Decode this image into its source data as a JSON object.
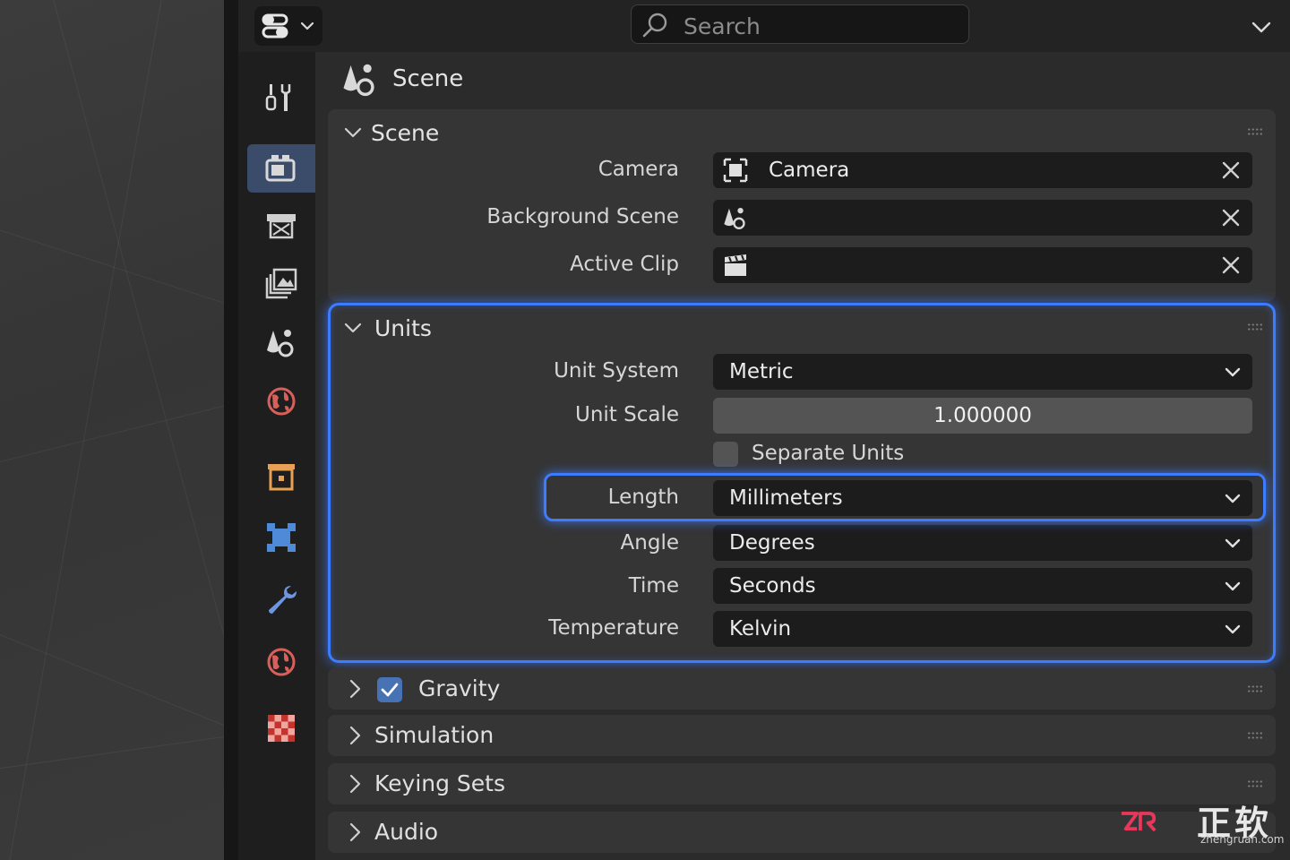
{
  "header": {
    "search_placeholder": "Search"
  },
  "properties": {
    "title": "Scene",
    "tabs": [
      {
        "name": "tool",
        "active": false
      },
      {
        "name": "render",
        "active": true
      },
      {
        "name": "output",
        "active": false
      },
      {
        "name": "view-layer",
        "active": false
      },
      {
        "name": "scene",
        "active": false
      },
      {
        "name": "world",
        "active": false
      },
      {
        "name": "collection",
        "active": false
      },
      {
        "name": "object",
        "active": false
      },
      {
        "name": "modifiers",
        "active": false
      },
      {
        "name": "physics",
        "active": false
      },
      {
        "name": "texture",
        "active": false
      }
    ]
  },
  "scene_panel": {
    "title": "Scene",
    "camera_label": "Camera",
    "camera_value": "Camera",
    "background_scene_label": "Background Scene",
    "active_clip_label": "Active Clip"
  },
  "units_panel": {
    "title": "Units",
    "unit_system_label": "Unit System",
    "unit_system_value": "Metric",
    "unit_scale_label": "Unit Scale",
    "unit_scale_value": "1.000000",
    "separate_units_label": "Separate Units",
    "separate_units_checked": false,
    "length_label": "Length",
    "length_value": "Millimeters",
    "angle_label": "Angle",
    "angle_value": "Degrees",
    "time_label": "Time",
    "time_value": "Seconds",
    "temperature_label": "Temperature",
    "temperature_value": "Kelvin"
  },
  "collapsed_panels": {
    "gravity": {
      "label": "Gravity",
      "checked": true
    },
    "simulation": {
      "label": "Simulation"
    },
    "keying_sets": {
      "label": "Keying Sets"
    },
    "audio": {
      "label": "Audio"
    }
  },
  "watermark": {
    "chinese": "正软",
    "url": "zhengruan.com"
  },
  "colors": {
    "highlight": "#3d7bff",
    "active_tab": "#3a4c6a",
    "checkbox_on": "#4772b3",
    "watermark_brand": "#e8375a"
  }
}
